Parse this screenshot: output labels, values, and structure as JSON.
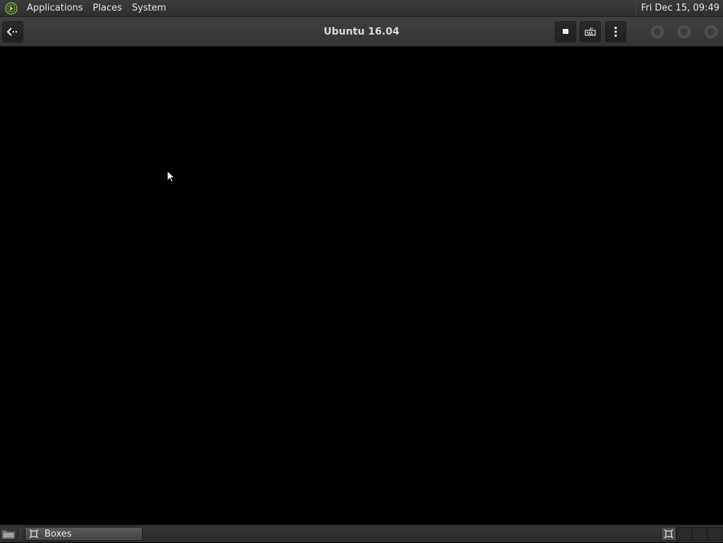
{
  "top_panel": {
    "menus": [
      "Applications",
      "Places",
      "System"
    ],
    "clock": "Fri Dec 15, 09:49"
  },
  "header_bar": {
    "title": "Ubuntu 16.04",
    "icons": {
      "back": "back-arrow-icon",
      "stop": "stop-icon",
      "keyboard": "keyboard-icon",
      "menu": "vertical-dots-menu-icon"
    }
  },
  "taskbar": {
    "tasks": [
      {
        "label": "Boxes",
        "icon": "boxes-app-icon"
      }
    ],
    "workspace_count": 4,
    "active_workspace": 1
  },
  "colors": {
    "accent_logo": "#8ab85a",
    "panel_bg": "#353535",
    "display_bg": "#000000"
  }
}
